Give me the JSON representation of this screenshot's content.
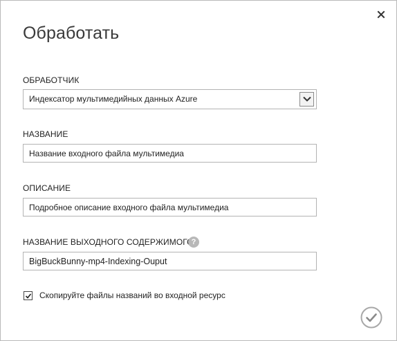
{
  "dialog": {
    "title": "Обработать",
    "close_icon": "close-icon",
    "ok_icon": "checkmark-circle-icon"
  },
  "processor": {
    "label": "ОБРАБОТЧИК",
    "selected": "Индексатор мультимедийных данных Azure",
    "arrow_icon": "chevron-down-icon"
  },
  "name": {
    "label": "НАЗВАНИЕ",
    "value": "Название входного файла мультимедиа"
  },
  "description": {
    "label": "ОПИСАНИЕ",
    "value": "Подробное описание входного файла мультимедиа"
  },
  "output": {
    "label": "НАЗВАНИЕ ВЫХОДНОГО СОДЕРЖИМОГО",
    "help_icon": "question-mark-icon",
    "help_glyph": "?",
    "value": "BigBuckBunny-mp4-Indexing-Ouput"
  },
  "copy_titles": {
    "label": "Скопируйте файлы названий во входной ресурс",
    "checked": true
  }
}
